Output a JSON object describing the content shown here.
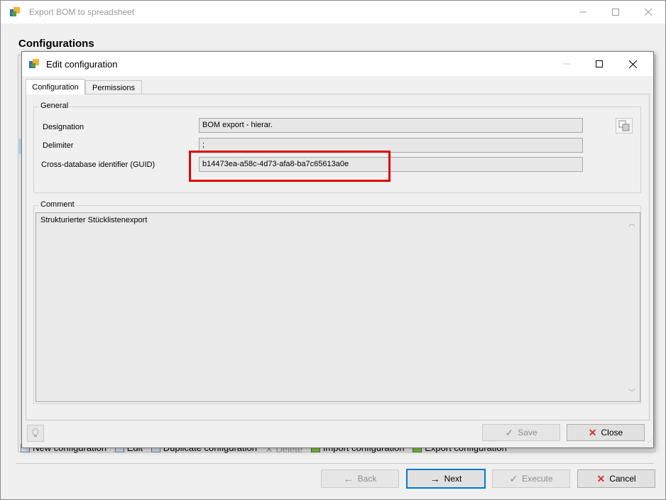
{
  "outer_window": {
    "title": "Export BOM to spreadsheet",
    "heading": "Configurations",
    "toolbar": {
      "new": "New configuration",
      "edit": "Edit",
      "duplicate": "Duplicate configuration",
      "delete": "Delete",
      "import": "Import configuration",
      "export": "Export configuration"
    },
    "buttons": {
      "back": "Back",
      "next": "Next",
      "execute": "Execute",
      "cancel": "Cancel"
    }
  },
  "dialog": {
    "title": "Edit configuration",
    "tabs": [
      "Configuration",
      "Permissions"
    ],
    "active_tab": "Configuration",
    "general": {
      "legend": "General",
      "fields": [
        {
          "label": "Designation",
          "value": "BOM export - hierar."
        },
        {
          "label": "Delimiter",
          "value": ";"
        },
        {
          "label": "Cross-database identifier (GUID)",
          "value": "b14473ea-a58c-4d73-afa8-ba7c65613a0e"
        }
      ]
    },
    "comment": {
      "legend": "Comment",
      "text": "Strukturierter Stücklistenexport"
    },
    "buttons": {
      "save": "Save",
      "close": "Close"
    }
  },
  "colors": {
    "highlight": "#e00000",
    "close_x": "#d32f2f",
    "primary_border": "#0078d7"
  },
  "icons": {
    "app": "app-icon",
    "translate": "translate-icon",
    "hint": "lightbulb-icon",
    "back": "arrow-left-icon",
    "next": "arrow-right-icon",
    "execute": "checkmark-icon",
    "cancel": "red-x-icon"
  }
}
